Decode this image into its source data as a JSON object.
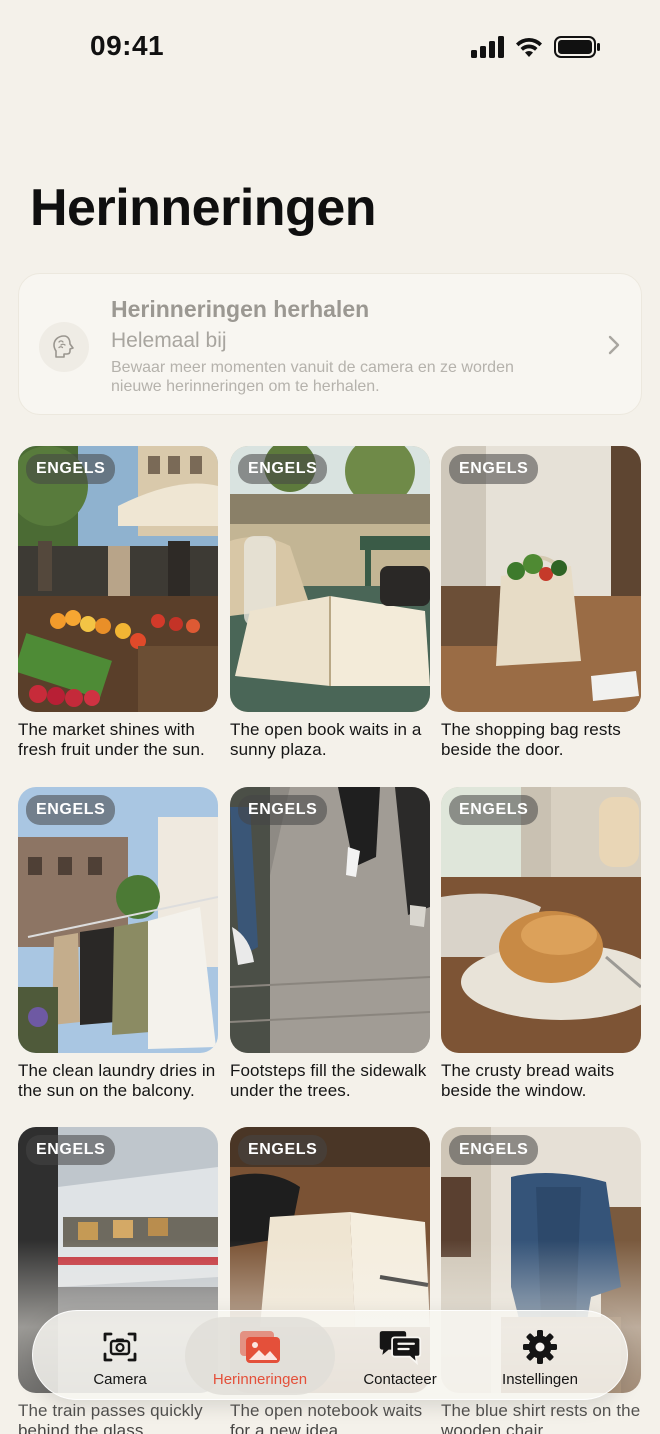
{
  "status_bar": {
    "time": "09:41"
  },
  "page": {
    "title": "Herinneringen"
  },
  "review_card": {
    "title": "Herinneringen herhalen",
    "subtitle": "Helemaal bij",
    "description": "Bewaar meer momenten vanuit de camera en ze worden nieuwe herinneringen om te herhalen."
  },
  "memories": [
    {
      "badge": "ENGELS",
      "caption": "The market shines with fresh fruit under the sun.",
      "image": "market-stall"
    },
    {
      "badge": "ENGELS",
      "caption": "The open book waits in a sunny plaza.",
      "image": "book-in-plaza"
    },
    {
      "badge": "ENGELS",
      "caption": "The shopping bag rests beside the door.",
      "image": "shopping-bag"
    },
    {
      "badge": "ENGELS",
      "caption": "The clean laundry dries in the sun on the balcony.",
      "image": "laundry"
    },
    {
      "badge": "ENGELS",
      "caption": "Footsteps fill the sidewalk under the trees.",
      "image": "sidewalk"
    },
    {
      "badge": "ENGELS",
      "caption": "The crusty bread waits beside the window.",
      "image": "bread"
    },
    {
      "badge": "ENGELS",
      "caption": "The train passes quickly behind the glass.",
      "image": "train"
    },
    {
      "badge": "ENGELS",
      "caption": "The open notebook waits for a new idea.",
      "image": "notebook"
    },
    {
      "badge": "ENGELS",
      "caption": "The blue shirt rests on the wooden chair.",
      "image": "shirt-on-chair"
    }
  ],
  "tab_bar": {
    "active": "Herinneringen",
    "accent_color": "#e4503a",
    "items": [
      {
        "label": "Camera",
        "icon": "camera-icon"
      },
      {
        "label": "Herinneringen",
        "icon": "photos-icon"
      },
      {
        "label": "Contacteer",
        "icon": "chat-bubbles-icon"
      },
      {
        "label": "Instellingen",
        "icon": "gear-icon"
      }
    ]
  }
}
